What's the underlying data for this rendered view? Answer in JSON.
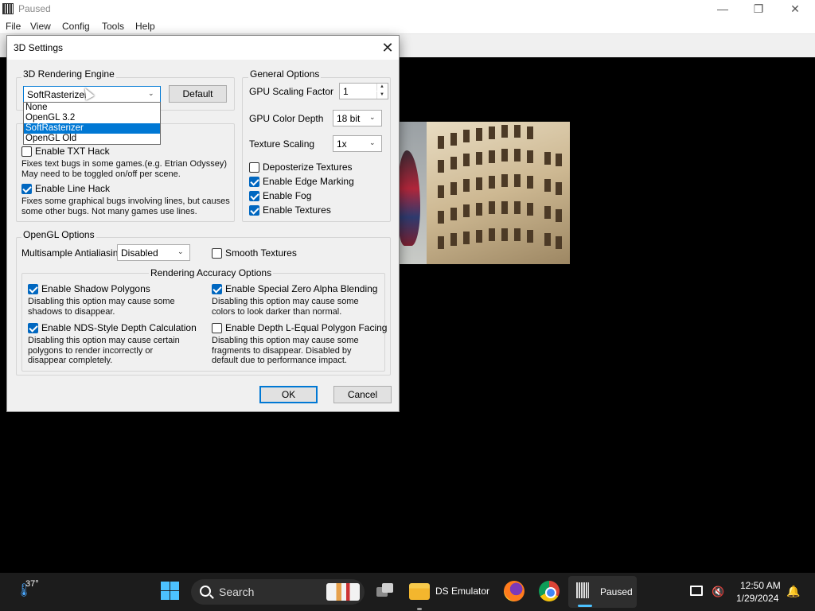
{
  "main_window": {
    "title": "Paused",
    "menu": [
      "File",
      "View",
      "Config",
      "Tools",
      "Help"
    ]
  },
  "dialog": {
    "title": "3D Settings",
    "rendering_engine": {
      "group_label": "3D Rendering Engine",
      "selected": "SoftRasterizer",
      "options": [
        "None",
        "OpenGL 3.2",
        "SoftRasterizer",
        "OpenGL Old"
      ],
      "default_button": "Default"
    },
    "hacks": {
      "txt_hack": {
        "label": "Enable TXT Hack",
        "checked": false,
        "desc": "Fixes text bugs in some games.(e.g. Etrian Odyssey) May need to be toggled on/off per scene."
      },
      "line_hack": {
        "label": "Enable Line Hack",
        "checked": true,
        "desc": "Fixes some graphical bugs involving lines, but causes some other bugs. Not many games use lines."
      }
    },
    "general": {
      "group_label": "General Options",
      "gpu_scaling_label": "GPU Scaling Factor",
      "gpu_scaling_value": "1",
      "gpu_color_depth_label": "GPU Color Depth",
      "gpu_color_depth_value": "18 bit",
      "texture_scaling_label": "Texture Scaling",
      "texture_scaling_value": "1x",
      "deposterize": {
        "label": "Deposterize Textures",
        "checked": false
      },
      "edge_marking": {
        "label": "Enable Edge Marking",
        "checked": true
      },
      "fog": {
        "label": "Enable Fog",
        "checked": true
      },
      "textures": {
        "label": "Enable Textures",
        "checked": true
      }
    },
    "opengl": {
      "group_label": "OpenGL Options",
      "msaa_label": "Multisample Antialiasing",
      "msaa_value": "Disabled",
      "smooth_textures": {
        "label": "Smooth Textures",
        "checked": false
      },
      "accuracy_label": "Rendering Accuracy Options",
      "shadow_polygons": {
        "label": "Enable Shadow Polygons",
        "checked": true,
        "desc": "Disabling this option may cause some shadows to disappear."
      },
      "zero_alpha": {
        "label": "Enable Special Zero Alpha Blending",
        "checked": true,
        "desc": "Disabling this option may cause some colors to look darker than normal."
      },
      "nds_depth": {
        "label": "Enable NDS-Style Depth Calculation",
        "checked": true,
        "desc": "Disabling this option may cause certain polygons to render incorrectly or disappear completely."
      },
      "depth_lequal": {
        "label": "Enable Depth L-Equal Polygon Facing",
        "checked": false,
        "desc": "Disabling this option may cause some fragments to disappear. Disabled by default due to performance impact."
      }
    },
    "ok_button": "OK",
    "cancel_button": "Cancel"
  },
  "taskbar": {
    "weather_temp": "37°",
    "search_label": "Search",
    "ds_emulator_label": "DS Emulator",
    "paused_label": "Paused",
    "clock_time": "12:50 AM",
    "clock_date": "1/29/2024"
  },
  "colors": {
    "accent": "#0078d4",
    "checkbox_on": "#0067c0",
    "taskbar_bg": "#1c1c1c"
  }
}
